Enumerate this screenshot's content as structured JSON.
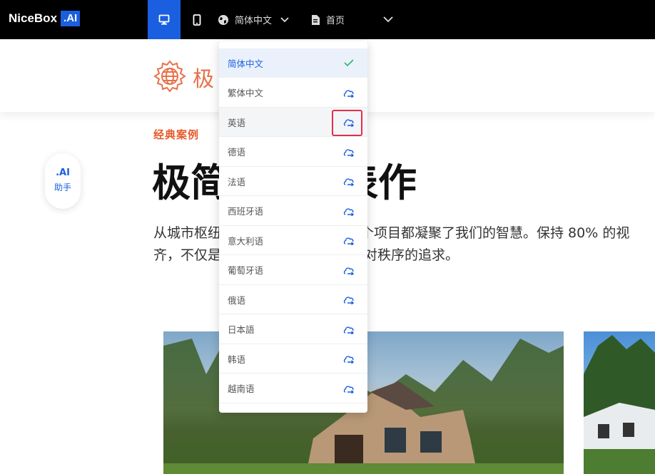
{
  "brand": {
    "name": "NiceBox",
    "badge": ".AI"
  },
  "toolbar": {
    "language_label": "简体中文",
    "page_label": "首页"
  },
  "header": {
    "title_partial": "极"
  },
  "ai_assistant": {
    "line1": ".AI",
    "line2": "助手"
  },
  "main": {
    "eyebrow": "经典案例",
    "headline_left": "极简",
    "headline_right": "表作",
    "paragraph_line1_left": "从城市枢纽",
    "paragraph_line1_right": "个项目都凝聚了我们的智慧。保持 80% 的视",
    "paragraph_line2_left": "齐，不仅是",
    "paragraph_line2_right": "对秩序的追求。"
  },
  "language_menu": {
    "items": [
      {
        "label": "简体中文",
        "status": "selected",
        "icon": "check-icon"
      },
      {
        "label": "繁体中文",
        "status": "translate",
        "icon": "ai-translate-icon"
      },
      {
        "label": "英语",
        "status": "translate",
        "icon": "ai-translate-icon"
      },
      {
        "label": "德语",
        "status": "translate",
        "icon": "ai-translate-icon"
      },
      {
        "label": "法语",
        "status": "translate",
        "icon": "ai-translate-icon"
      },
      {
        "label": "西班牙语",
        "status": "translate",
        "icon": "ai-translate-icon"
      },
      {
        "label": "意大利语",
        "status": "translate",
        "icon": "ai-translate-icon"
      },
      {
        "label": "葡萄牙语",
        "status": "translate",
        "icon": "ai-translate-icon"
      },
      {
        "label": "俄语",
        "status": "translate",
        "icon": "ai-translate-icon"
      },
      {
        "label": "日本語",
        "status": "translate",
        "icon": "ai-translate-icon"
      },
      {
        "label": "韩语",
        "status": "translate",
        "icon": "ai-translate-icon"
      },
      {
        "label": "越南语",
        "status": "translate",
        "icon": "ai-translate-icon"
      }
    ]
  },
  "colors": {
    "accent": "#1a5fe0",
    "orange": "#e8714a",
    "check": "#2bb673",
    "highlight_border": "#e0304a",
    "topbar": "#000000"
  }
}
